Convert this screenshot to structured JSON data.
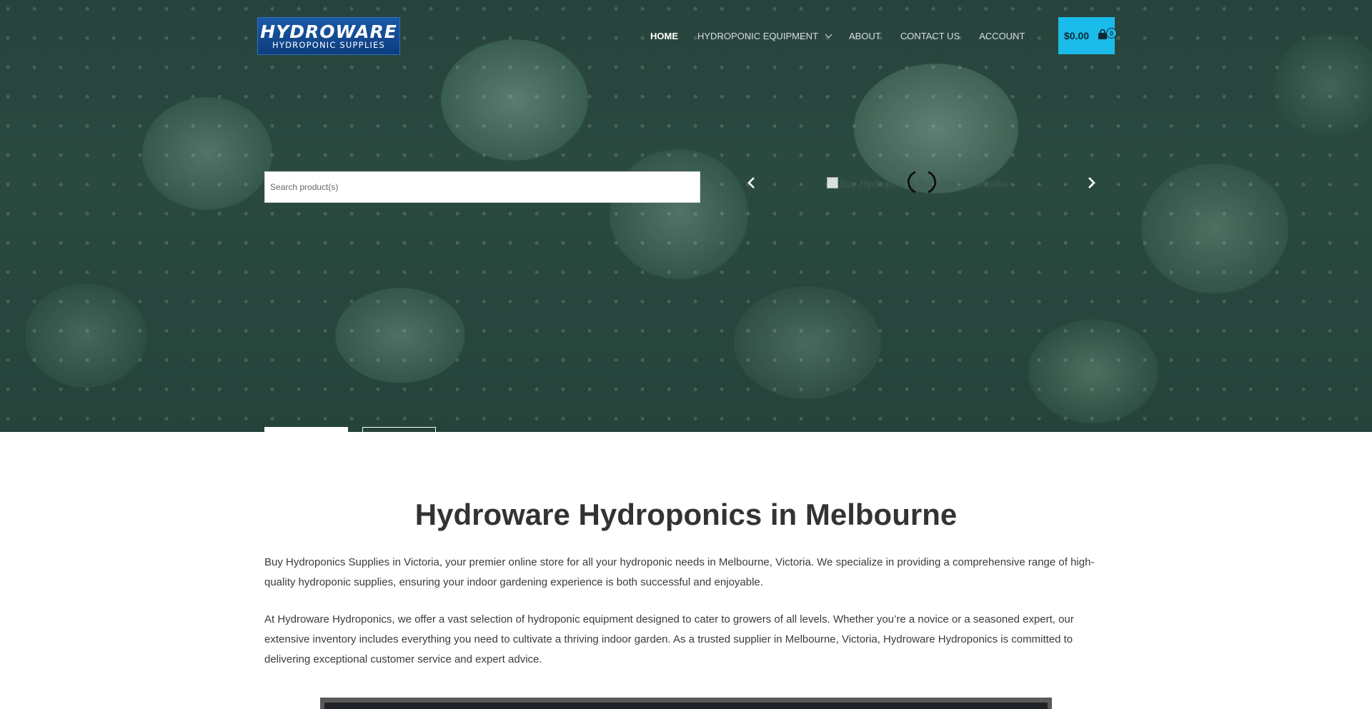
{
  "header": {
    "logo": {
      "main": "HYDROWARE",
      "sub": "HYDROPONIC SUPPLIES"
    },
    "nav": [
      {
        "label": "HOME",
        "active": true
      },
      {
        "label": "HYDROPONIC EQUIPMENT",
        "has_dropdown": true
      },
      {
        "label": "ABOUT"
      },
      {
        "label": "CONTACT US"
      },
      {
        "label": "ACCOUNT"
      }
    ],
    "cart": {
      "amount": "$0.00",
      "count": "0",
      "accent": "#1bbbe9"
    }
  },
  "hero": {
    "search_placeholder": "Search product(s)",
    "slide_alt": "Buy Hydroponics Supplies in Australia"
  },
  "main": {
    "title": "Hydroware Hydroponics in Melbourne",
    "paragraphs": [
      "Buy Hydroponics Supplies in Victoria, your premier online store for all your hydroponic needs in Melbourne, Victoria. We specialize in providing a comprehensive range of high-quality hydroponic supplies, ensuring your indoor gardening experience is both successful and enjoyable.",
      "At Hydroware Hydroponics, we offer a vast selection of hydroponic equipment designed to cater to growers of all levels. Whether you’re a novice or a seasoned expert, our extensive inventory includes everything you need to cultivate a thriving indoor garden. As a trusted supplier in Melbourne, Victoria, Hydroware Hydroponics is committed to delivering exceptional customer service and expert advice."
    ]
  }
}
